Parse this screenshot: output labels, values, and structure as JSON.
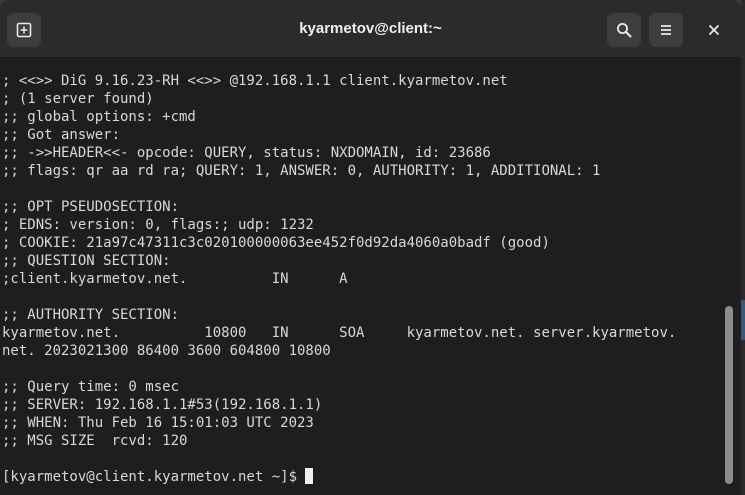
{
  "window": {
    "title": "kyarmetov@client:~"
  },
  "header": {
    "new_tab_icon": "new-tab-icon",
    "search_icon": "search-icon",
    "menu_icon": "hamburger-menu-icon",
    "close_icon": "close-icon"
  },
  "terminal": {
    "lines": [
      "; <<>> DiG 9.16.23-RH <<>> @192.168.1.1 client.kyarmetov.net",
      "; (1 server found)",
      ";; global options: +cmd",
      ";; Got answer:",
      ";; ->>HEADER<<- opcode: QUERY, status: NXDOMAIN, id: 23686",
      ";; flags: qr aa rd ra; QUERY: 1, ANSWER: 0, AUTHORITY: 1, ADDITIONAL: 1",
      "",
      ";; OPT PSEUDOSECTION:",
      "; EDNS: version: 0, flags:; udp: 1232",
      "; COOKIE: 21a97c47311c3c020100000063ee452f0d92da4060a0badf (good)",
      ";; QUESTION SECTION:",
      ";client.kyarmetov.net.          IN      A",
      "",
      ";; AUTHORITY SECTION:",
      "kyarmetov.net.          10800   IN      SOA     kyarmetov.net. server.kyarmetov.",
      "net. 2023021300 86400 3600 604800 10800",
      "",
      ";; Query time: 0 msec",
      ";; SERVER: 192.168.1.1#53(192.168.1.1)",
      ";; WHEN: Thu Feb 16 15:01:03 UTC 2023",
      ";; MSG SIZE  rcvd: 120",
      ""
    ],
    "prompt": "[kyarmetov@client.kyarmetov.net ~]$ "
  },
  "colors": {
    "titlebar": "#2b2b2b",
    "terminal_bg": "#1e1e1e",
    "text": "#d8d8d8",
    "button_bg": "#3d3d3d"
  }
}
